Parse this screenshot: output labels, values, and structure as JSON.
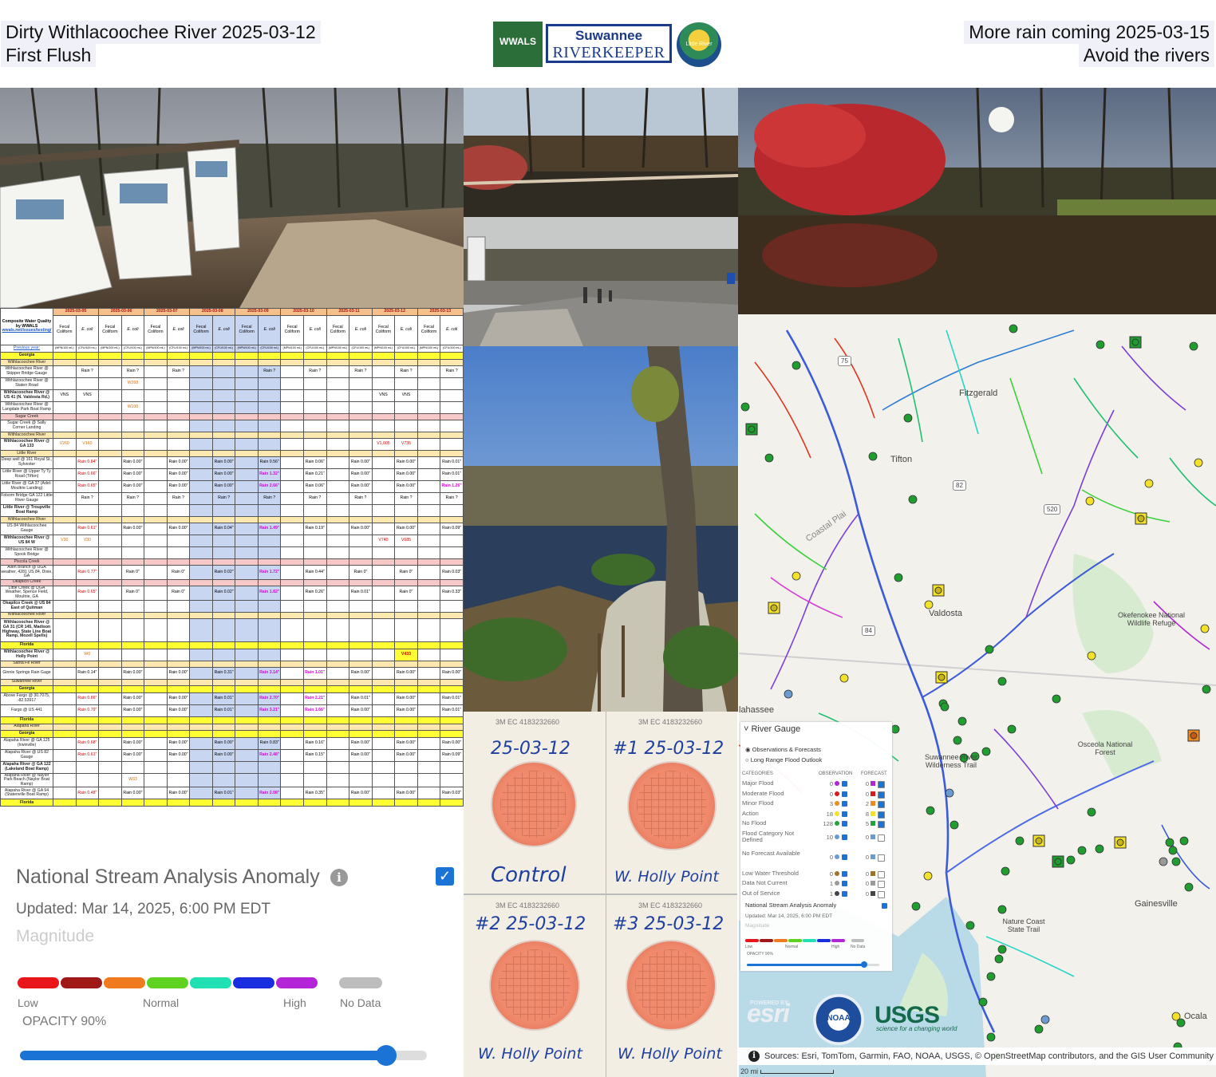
{
  "header": {
    "left_line1": "Dirty Withlacoochee River 2025-03-12",
    "left_line2": "First Flush",
    "right_line1": "More rain coming 2025-03-15",
    "right_line2": "Avoid the rivers"
  },
  "logos": {
    "wwals": "WWALS",
    "riverkeeper_line1": "Suwannee",
    "riverkeeper_line2": "RIVERKEEPER",
    "little_river": "Little River"
  },
  "table": {
    "corner": "Composite Water Quality by WWALS",
    "corner_link": "wwals.net/issues/testing/",
    "previous_year": "Previous year:",
    "dates": [
      "2025-03-05",
      "2025-03-06",
      "2025-03-07",
      "2025-03-08",
      "2025-03-09",
      "2025-03-10",
      "2025-03-11",
      "2025-03-12",
      "2025-03-13"
    ],
    "col_fecal": "Fecal Coliform",
    "col_ecoli": "E. coli",
    "unit_fecal": "(MPN/100 mL)",
    "unit_ecoli": "(CFU/100 mL)",
    "rows": [
      {
        "type": "state",
        "label": "Georgia"
      },
      {
        "type": "section",
        "label": "Withlacoochee River"
      },
      {
        "type": "data",
        "label": "Withlacoochee River @ Skipper Bridge Gauge",
        "cells": [
          "",
          "Rain ?",
          "",
          "Rain ?",
          "",
          "Rain ?",
          "",
          "",
          "",
          "Rain ?",
          "",
          "Rain ?",
          "",
          "Rain ?",
          "",
          "Rain ?",
          "",
          "Rain ?"
        ]
      },
      {
        "type": "data",
        "label": "Withlacoochee River @ Staten Road",
        "cells": [
          "",
          "",
          "",
          "W268",
          "",
          "",
          "",
          "",
          "",
          "",
          "",
          "",
          "",
          "",
          "",
          "",
          "",
          ""
        ]
      },
      {
        "type": "data",
        "label": "Withlacoochee River @ US 41 (N. Valdosta Rd.)",
        "bold": true,
        "cells": [
          "VNS",
          "VNS",
          "",
          "",
          "",
          "",
          "",
          "",
          "",
          "",
          "",
          "",
          "",
          "",
          "VNS",
          "VNS",
          "",
          ""
        ]
      },
      {
        "type": "data",
        "label": "Withlacoochee River @ Langdale Park Boat Ramp",
        "cells": [
          "",
          "",
          "",
          "W100",
          "",
          "",
          "",
          "",
          "",
          "",
          "",
          "",
          "",
          "",
          "",
          "",
          "",
          ""
        ]
      },
      {
        "type": "pink",
        "label": "Sugar Creek"
      },
      {
        "type": "data",
        "label": "Sugar Creek @ Sally Corner Landing",
        "cells": [
          "",
          "",
          "",
          "",
          "",
          "",
          "",
          "",
          "",
          "",
          "",
          "",
          "",
          "",
          "",
          "",
          "",
          ""
        ]
      },
      {
        "type": "section",
        "label": "Withlacoochee River"
      },
      {
        "type": "data",
        "label": "Withlacoochee River @ GA 133",
        "bold": true,
        "cells": [
          "V260",
          "V160",
          "",
          "",
          "",
          "",
          "",
          "",
          "",
          "",
          "",
          "",
          "",
          "",
          "V1,005",
          "V735",
          "",
          ""
        ]
      },
      {
        "type": "section",
        "label": "Little River"
      },
      {
        "type": "data",
        "label": "Deep well @ 161 Royal St., Sylvester",
        "cells": [
          "",
          "Rain 0.84\"",
          "",
          "Rain 0.00\"",
          "",
          "Rain 0.00\"",
          "",
          "Rain 0.00\"",
          "",
          "Rain 0.56\"",
          "",
          "Rain 0.06\"",
          "",
          "Rain 0.00\"",
          "",
          "Rain 0.00\"",
          "",
          "Rain 0.01\""
        ]
      },
      {
        "type": "data",
        "label": "Little River @ Upper Ty Ty Road (Tifton)",
        "cells": [
          "",
          "Rain 0.66\"",
          "",
          "Rain 0.00\"",
          "",
          "Rain 0.00\"",
          "",
          "Rain 0.00\"",
          "",
          "Rain 1.32\"",
          "",
          "Rain 0.21\"",
          "",
          "Rain 0.00\"",
          "",
          "Rain 0.00\"",
          "",
          "Rain 0.01\""
        ]
      },
      {
        "type": "data",
        "label": "Little River @ GA 37 (Adel-Moultrie Landing)",
        "cells": [
          "",
          "Rain 0.65\"",
          "",
          "Rain 0.00\"",
          "",
          "Rain 0.00\"",
          "",
          "Rain 0.00\"",
          "",
          "Rain 2.66\"",
          "",
          "Rain 0.06\"",
          "",
          "Rain 0.00\"",
          "",
          "Rain 0.00\"",
          "",
          "Rain 1.26\""
        ]
      },
      {
        "type": "data",
        "label": "Folsom Bridge GA 122 Little River Gauge",
        "cells": [
          "",
          "Rain ?",
          "",
          "Rain ?",
          "",
          "Rain ?",
          "",
          "Rain ?",
          "",
          "Rain ?",
          "",
          "Rain ?",
          "",
          "Rain ?",
          "",
          "Rain ?",
          "",
          "Rain ?"
        ]
      },
      {
        "type": "data",
        "label": "Little River @ Troupville Boat Ramp",
        "bold": true,
        "cells": [
          "",
          "",
          "",
          "",
          "",
          "",
          "",
          "",
          "",
          "",
          "",
          "",
          "",
          "",
          "",
          "",
          "",
          ""
        ]
      },
      {
        "type": "section",
        "label": "Withlacoochee River"
      },
      {
        "type": "data",
        "label": "US 84 Withlacoochee Gauge",
        "cells": [
          "",
          "Rain 0.61\"",
          "",
          "Rain 0.00\"",
          "",
          "Rain 0.00\"",
          "",
          "Rain 0.04\"",
          "",
          "Rain 1.49\"",
          "",
          "Rain 0.19\"",
          "",
          "Rain 0.00\"",
          "",
          "Rain 0.00\"",
          "",
          "Rain 0.09\""
        ]
      },
      {
        "type": "data",
        "label": "Withlacoochee River @ US 84 W",
        "bold": true,
        "cells": [
          "V30",
          "V30",
          "",
          "",
          "",
          "",
          "",
          "",
          "",
          "",
          "",
          "",
          "",
          "",
          "V740",
          "V685",
          "",
          ""
        ]
      },
      {
        "type": "data",
        "label": "Withlacoochee River @ Spook Bridge",
        "cells": [
          "",
          "",
          "",
          "",
          "",
          "",
          "",
          "",
          "",
          "",
          "",
          "",
          "",
          "",
          "",
          "",
          "",
          ""
        ]
      },
      {
        "type": "pink",
        "label": "Piscola Creek"
      },
      {
        "type": "data",
        "label": "Allen Branch @ UGA weather, 4281 US 84, Dixie, GA",
        "cells": [
          "",
          "Rain 0.77\"",
          "",
          "Rain 0\"",
          "",
          "Rain 0\"",
          "",
          "Rain 0.02\"",
          "",
          "Rain 1.72\"",
          "",
          "Rain 0.44\"",
          "",
          "Rain 0\"",
          "",
          "Rain 0\"",
          "",
          "Rain 0.03\""
        ]
      },
      {
        "type": "pink",
        "label": "Okapilco Creek"
      },
      {
        "type": "data",
        "label": "Little Creek @ UGA Weather, Spence Field, Moultrie, GA",
        "cells": [
          "",
          "Rain 0.65\"",
          "",
          "Rain 0\"",
          "",
          "Rain 0\"",
          "",
          "Rain 0.02\"",
          "",
          "Rain 1.82\"",
          "",
          "Rain 0.26\"",
          "",
          "Rain 0.01\"",
          "",
          "Rain 0\"",
          "",
          "Rain 0.33\""
        ]
      },
      {
        "type": "data",
        "label": "Okapilco Creek @ US 84 East of Quitman",
        "bold": true,
        "cells": [
          "",
          "",
          "",
          "",
          "",
          "",
          "",
          "",
          "",
          "",
          "",
          "",
          "",
          "",
          "",
          "",
          "",
          ""
        ]
      },
      {
        "type": "section",
        "label": "Withlacoochee River"
      },
      {
        "type": "data",
        "label": "Withlacoochee River @ GA 31 (CR 145, Madison Highway, State Line Boat Ramp, Mozell Spells)",
        "bold": true,
        "tall": true,
        "cells": [
          "",
          "",
          "",
          "",
          "",
          "",
          "",
          "",
          "",
          "",
          "",
          "",
          "",
          "",
          "",
          "",
          "",
          ""
        ]
      },
      {
        "type": "state",
        "label": "Florida"
      },
      {
        "type": "data",
        "label": "Withlacoochee River @ Holly Point",
        "bold": true,
        "cells": [
          "",
          "W0",
          "",
          "",
          "",
          "",
          "",
          "",
          "",
          "",
          "",
          "",
          "",
          "",
          "",
          "V433",
          "",
          ""
        ]
      },
      {
        "type": "section",
        "label": "Santa Fe River"
      },
      {
        "type": "data",
        "label": "Ginnie Springs Rain Gage",
        "cells": [
          "",
          "Rain 0.14\"",
          "",
          "Rain 0.00\"",
          "",
          "Rain 0.00\"",
          "",
          "Rain 0.31\"",
          "",
          "Rain 3.14\"",
          "",
          "Rain 1.01\"",
          "",
          "Rain 0.00\"",
          "",
          "Rain 0.00\"",
          "",
          "Rain 0.00\""
        ]
      },
      {
        "type": "section",
        "label": "Suwannee River"
      },
      {
        "type": "state",
        "label": "Georgia"
      },
      {
        "type": "data",
        "label": "Above Fargo @ 30.7075, -82.53917",
        "cells": [
          "",
          "Rain 0.86\"",
          "",
          "Rain 0.00\"",
          "",
          "Rain 0.00\"",
          "",
          "Rain 0.01\"",
          "",
          "Rain 2.70\"",
          "",
          "Rain 2.21\"",
          "",
          "Rain 0.01\"",
          "",
          "Rain 0.00\"",
          "",
          "Rain 0.01\""
        ]
      },
      {
        "type": "data",
        "label": "Fargo @ US 441",
        "cells": [
          "",
          "Rain 0.79\"",
          "",
          "Rain 0.00\"",
          "",
          "Rain 0.00\"",
          "",
          "Rain 0.01\"",
          "",
          "Rain 3.21\"",
          "",
          "Rain 1.66\"",
          "",
          "Rain 0.00\"",
          "",
          "Rain 0.00\"",
          "",
          "Rain 0.01\""
        ]
      },
      {
        "type": "state",
        "label": "Florida"
      },
      {
        "type": "section",
        "label": "Alapaha River"
      },
      {
        "type": "state",
        "label": "Georgia"
      },
      {
        "type": "data",
        "label": "Alapaha River @ GA 125 (Irwinville)",
        "cells": [
          "",
          "Rain 0.68\"",
          "",
          "Rain 0.00\"",
          "",
          "Rain 0.00\"",
          "",
          "Rain 0.00\"",
          "",
          "Rain 0.83\"",
          "",
          "Rain 0.16\"",
          "",
          "Rain 0.00\"",
          "",
          "Rain 0.00\"",
          "",
          "Rain 0.00\""
        ]
      },
      {
        "type": "data",
        "label": "Alapaha River @ US 82 Gauge",
        "cells": [
          "",
          "Rain 0.61\"",
          "",
          "Rain 0.00\"",
          "",
          "Rain 0.00\"",
          "",
          "Rain 0.00\"",
          "",
          "Rain 2.48\"",
          "",
          "Rain 0.15\"",
          "",
          "Rain 0.00\"",
          "",
          "Rain 0.00\"",
          "",
          "Rain 0.09\""
        ]
      },
      {
        "type": "data",
        "label": "Alapaha River @ GA 122 (Lakeland Boat Ramp)",
        "bold": true,
        "cells": [
          "",
          "",
          "",
          "",
          "",
          "",
          "",
          "",
          "",
          "",
          "",
          "",
          "",
          "",
          "",
          "",
          "",
          ""
        ]
      },
      {
        "type": "data",
        "label": "Alapaha River @ Naylor Park Beach (Naylor Boat Ramp)",
        "cells": [
          "",
          "",
          "",
          "W33",
          "",
          "",
          "",
          "",
          "",
          "",
          "",
          "",
          "",
          "",
          "",
          "",
          "",
          ""
        ]
      },
      {
        "type": "data",
        "label": "Alapaha River @ GA 94 (Statenville Boat Ramp)",
        "cells": [
          "",
          "Rain 0.48\"",
          "",
          "Rain 0.00\"",
          "",
          "Rain 0.00\"",
          "",
          "Rain 0.01\"",
          "",
          "Rain 2.08\"",
          "",
          "Rain 0.35\"",
          "",
          "Rain 0.00\"",
          "",
          "Rain 0.00\"",
          "",
          "Rain 0.03\""
        ]
      },
      {
        "type": "state",
        "label": "Florida"
      }
    ]
  },
  "nsa_panel": {
    "title": "National Stream Analysis Anomaly",
    "updated": "Updated: Mar 14, 2025, 6:00 PM EDT",
    "magnitude": "Magnitude",
    "low": "Low",
    "normal": "Normal",
    "high": "High",
    "no_data": "No Data",
    "opacity": "OPACITY 90%",
    "opacity_value": 0.9,
    "colors": [
      "#e8161b",
      "#a01818",
      "#f07a1e",
      "#5fd11f",
      "#20e0b4",
      "#1a2ee0",
      "#b324d6"
    ],
    "no_data_color": "#bdbdbd"
  },
  "plates": {
    "top_left_date": "25-03-12",
    "top_right": "#1 25-03-12",
    "bottom_left": "#2 25-03-12",
    "bottom_right": "#3 25-03-12",
    "control": "Control",
    "holly1": "W. Holly Point",
    "holly2": "W. Holly Point",
    "holly3": "W. Holly Point",
    "lot_mark": "3M EC 4183232660"
  },
  "map": {
    "places": {
      "fitzgerald": "Fitzgerald",
      "tifton": "Tifton",
      "valdosta": "Valdosta",
      "okefenokee": "Okefenokee National Wildlife Refuge",
      "tallahassee": "lahassee",
      "suwannee_trail": "Suwannee River Wilderness Trail",
      "osceola": "Osceola National Forest",
      "gainesville": "Gainesville",
      "nature_coast": "Nature Coast State Trail",
      "ocala": "Ocala",
      "coastal_plain": "Coastal Plai"
    },
    "road_labels": [
      "75",
      "82",
      "520",
      "84"
    ],
    "attribution": "Sources: Esri, TomTom, Garmin, FAO, NOAA, USGS, © OpenStreetMap contributors, and the GIS User Community",
    "scale": "20 mi",
    "esri": "esri",
    "esri_powered": "POWERED BY",
    "noaa": "NOAA",
    "usgs": "USGS",
    "usgs_tag": "science for a changing world"
  },
  "gauge_panel": {
    "title": "River Gauge",
    "opt1": "Observations & Forecasts",
    "opt2": "Long Range Flood Outlook",
    "col_categories": "CATEGORIES",
    "col_observation": "OBSERVATION",
    "col_forecast": "FORECAST",
    "categories": [
      {
        "name": "Major Flood",
        "obs": "0",
        "fc": "0",
        "color": "#b324d6"
      },
      {
        "name": "Moderate Flood",
        "obs": "0",
        "fc": "0",
        "color": "#d81c1c"
      },
      {
        "name": "Minor Flood",
        "obs": "3",
        "fc": "2",
        "color": "#f08a1e"
      },
      {
        "name": "Action",
        "obs": "18",
        "fc": "8",
        "color": "#f3e12a"
      },
      {
        "name": "No Flood",
        "obs": "128",
        "fc": "5",
        "color": "#23a33a"
      },
      {
        "name": "Flood Category Not Defined",
        "obs": "10",
        "fc": "0",
        "color": "#6c9bd1"
      },
      {
        "name": "No Forecast Available",
        "obs": "0",
        "fc": "0",
        "color": "#6c9bd1"
      },
      {
        "name": "Low Water Threshold",
        "obs": "0",
        "fc": "0",
        "color": "#a0722a"
      },
      {
        "name": "Data Not Current",
        "obs": "1",
        "fc": "0",
        "color": "#9a9a9a"
      },
      {
        "name": "Out of Service",
        "obs": "1",
        "fc": "0",
        "color": "#444444"
      }
    ],
    "nsa_title": "National Stream Analysis Anomaly",
    "nsa_updated": "Updated: Mar 14, 2025, 6:00 PM EDT",
    "nsa_magnitude": "Magnitude",
    "low": "Low",
    "normal": "Normal",
    "high": "High",
    "no_data": "No Data",
    "opacity": "OPACITY 90%"
  }
}
